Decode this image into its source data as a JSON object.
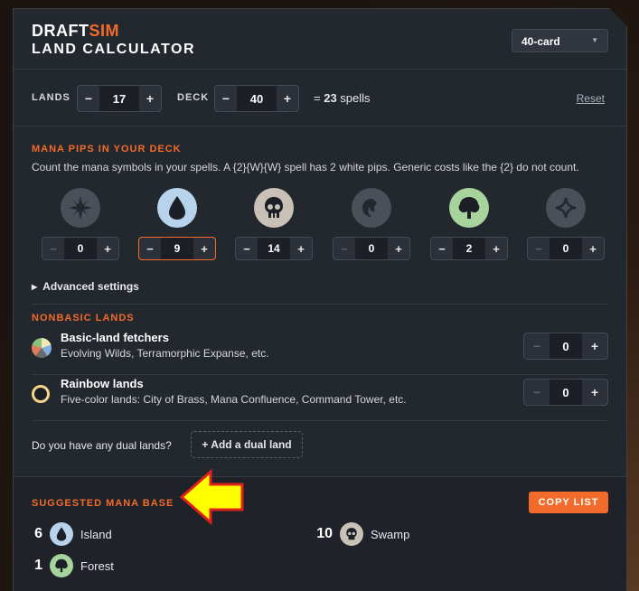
{
  "app": {
    "logo_draft": "DRAFT",
    "logo_sim": "SIM",
    "title": "LAND CALCULATOR"
  },
  "deck_size_select": {
    "value": "40-card"
  },
  "counts": {
    "lands_label": "LANDS",
    "lands_value": "17",
    "deck_label": "DECK",
    "deck_value": "40",
    "spells_prefix": "= ",
    "spells_value": "23",
    "spells_suffix": " spells",
    "reset_label": "Reset"
  },
  "pips": {
    "heading": "MANA PIPS IN YOUR DECK",
    "description": "Count the mana symbols in your spells. A {2}{W}{W} spell has 2 white pips. Generic costs like the {2} do not count.",
    "colors": [
      {
        "name": "white",
        "value": "0",
        "icon": "white-mana-icon",
        "bg": "#4a4f58"
      },
      {
        "name": "blue",
        "value": "9",
        "icon": "blue-mana-icon",
        "bg": "#b8d4ec"
      },
      {
        "name": "black",
        "value": "14",
        "icon": "black-mana-icon",
        "bg": "#c9c0b6"
      },
      {
        "name": "red",
        "value": "0",
        "icon": "red-mana-icon",
        "bg": "#4a4f58"
      },
      {
        "name": "green",
        "value": "2",
        "icon": "green-mana-icon",
        "bg": "#a7d49c"
      },
      {
        "name": "colorless",
        "value": "0",
        "icon": "colorless-mana-icon",
        "bg": "#4a4f58"
      }
    ]
  },
  "advanced": {
    "label": "Advanced settings"
  },
  "nonbasic": {
    "heading": "NONBASIC LANDS",
    "items": [
      {
        "title": "Basic-land fetchers",
        "subtitle": "Evolving Wilds, Terramorphic Expanse, etc.",
        "value": "0"
      },
      {
        "title": "Rainbow lands",
        "subtitle": "Five-color lands: City of Brass, Mana Confluence, Command Tower, etc.",
        "value": "0"
      }
    ],
    "dual_question": "Do you have any dual lands?",
    "add_dual_label": "+ Add a dual land"
  },
  "suggested": {
    "heading": "SUGGESTED MANA BASE",
    "copy_label": "COPY LIST",
    "lands": [
      {
        "count": "6",
        "name": "Island",
        "icon": "island-icon"
      },
      {
        "count": "10",
        "name": "Swamp",
        "icon": "swamp-icon"
      },
      {
        "count": "1",
        "name": "Forest",
        "icon": "forest-icon"
      }
    ]
  },
  "colors": {
    "accent": "#f26b2a",
    "panel": "#23272e",
    "arrow_fill": "#ffff00",
    "arrow_stroke": "#e0201a"
  }
}
